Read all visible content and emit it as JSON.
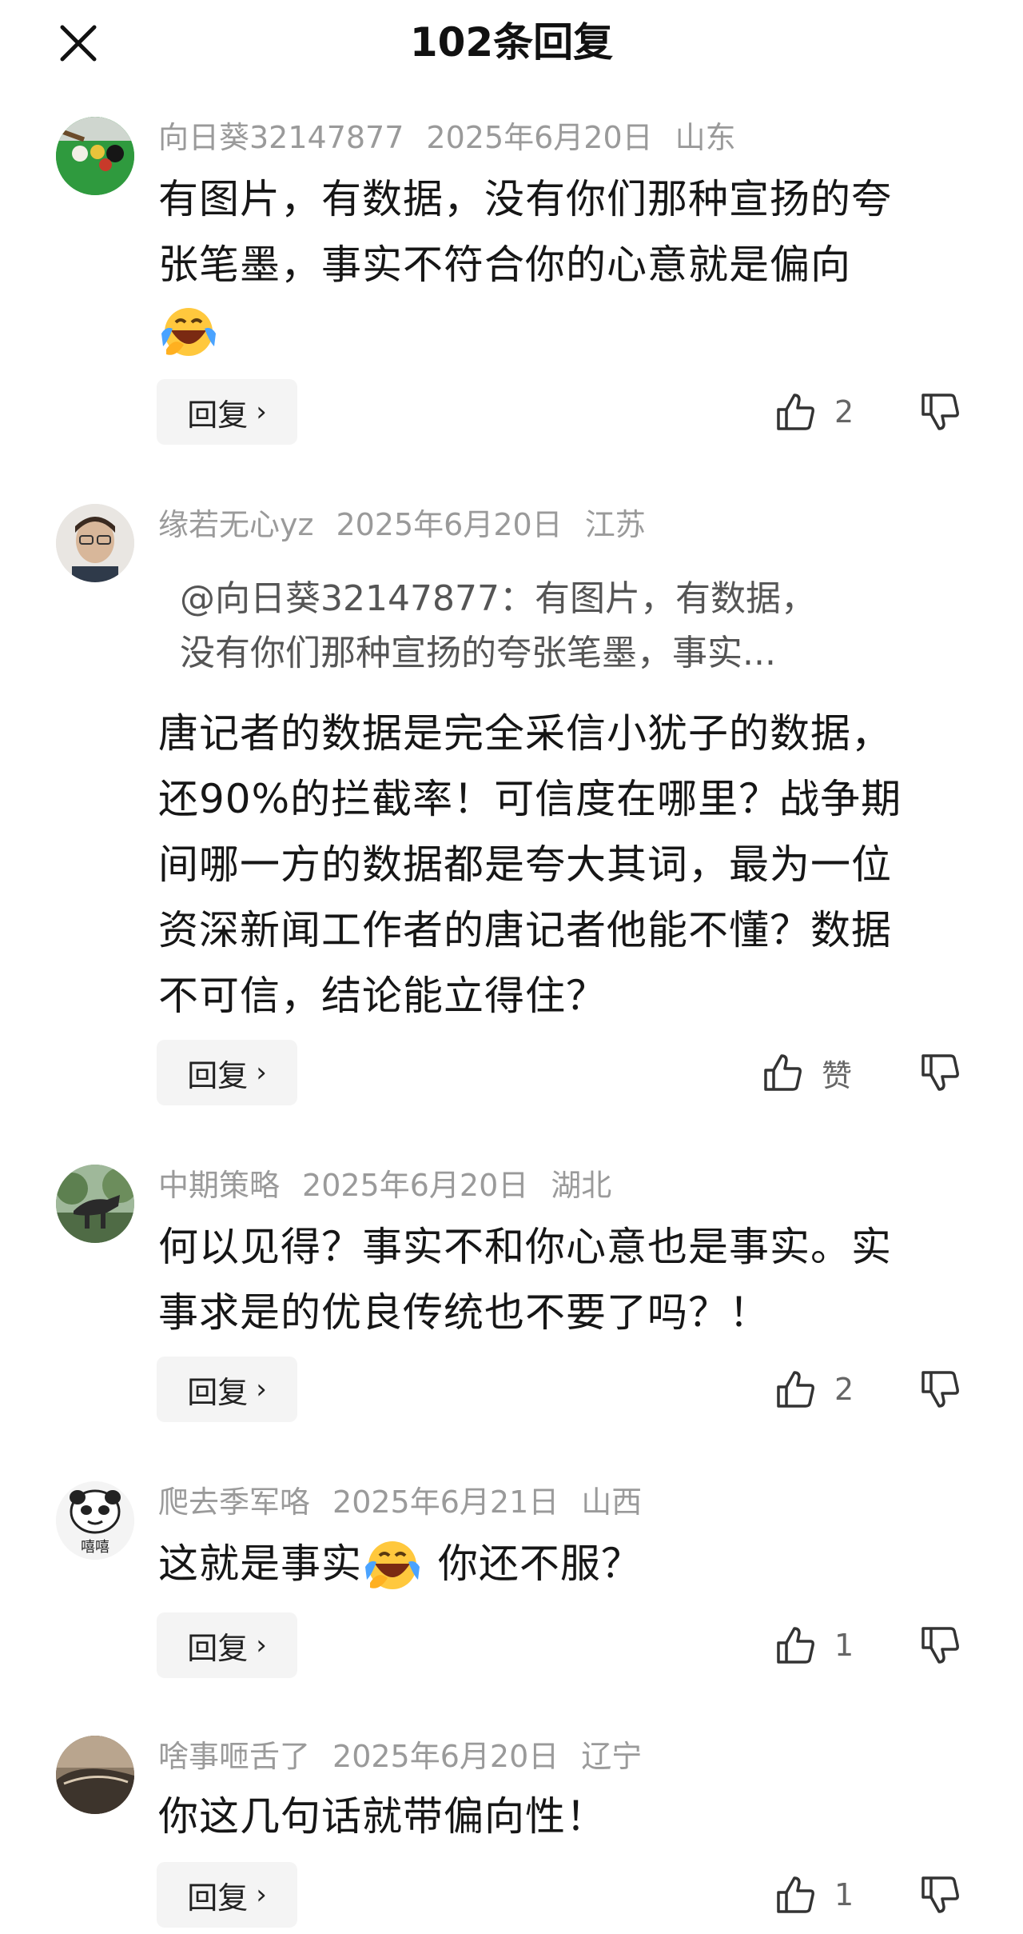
{
  "header": {
    "title": "102条回复",
    "close_icon": "close-icon"
  },
  "reply_label": "回复",
  "comments": [
    {
      "user": "向日葵32147877",
      "date": "2025年6月20日",
      "location": "山东",
      "lines": [
        "有图片，有数据，没有你们那种宣扬的夸",
        "张笔墨，事实不符合你的心意就是偏向"
      ],
      "likes": "2"
    },
    {
      "user": "缘若无心yz",
      "date": "2025年6月20日",
      "location": "江苏",
      "quote": [
        "@向日葵32147877：有图片，有数据，",
        "没有你们那种宣扬的夸张笔墨，事实..."
      ],
      "lines": [
        "唐记者的数据是完全采信小犹子的数据，",
        "还90%的拦截率！可信度在哪里？战争期",
        "间哪一方的数据都是夸大其词，最为一位",
        "资深新闻工作者的唐记者他能不懂？数据",
        "不可信，结论能立得住？"
      ],
      "likes": "赞"
    },
    {
      "user": "中期策略",
      "date": "2025年6月20日",
      "location": "湖北",
      "lines": [
        "何以见得？事实不和你心意也是事实。实",
        "事求是的优良传统也不要了吗？！"
      ],
      "likes": "2"
    },
    {
      "user": "爬去季军咯",
      "date": "2025年6月21日",
      "location": "山西",
      "line_before_emoji": "这就是事实",
      "line_after_emoji": " 你还不服？",
      "avatar_caption": "嘻嘻",
      "likes": "1"
    },
    {
      "user": "啥事咂舌了",
      "date": "2025年6月20日",
      "location": "辽宁",
      "lines": [
        "你这几句话就带偏向性！"
      ],
      "likes": "1"
    }
  ]
}
